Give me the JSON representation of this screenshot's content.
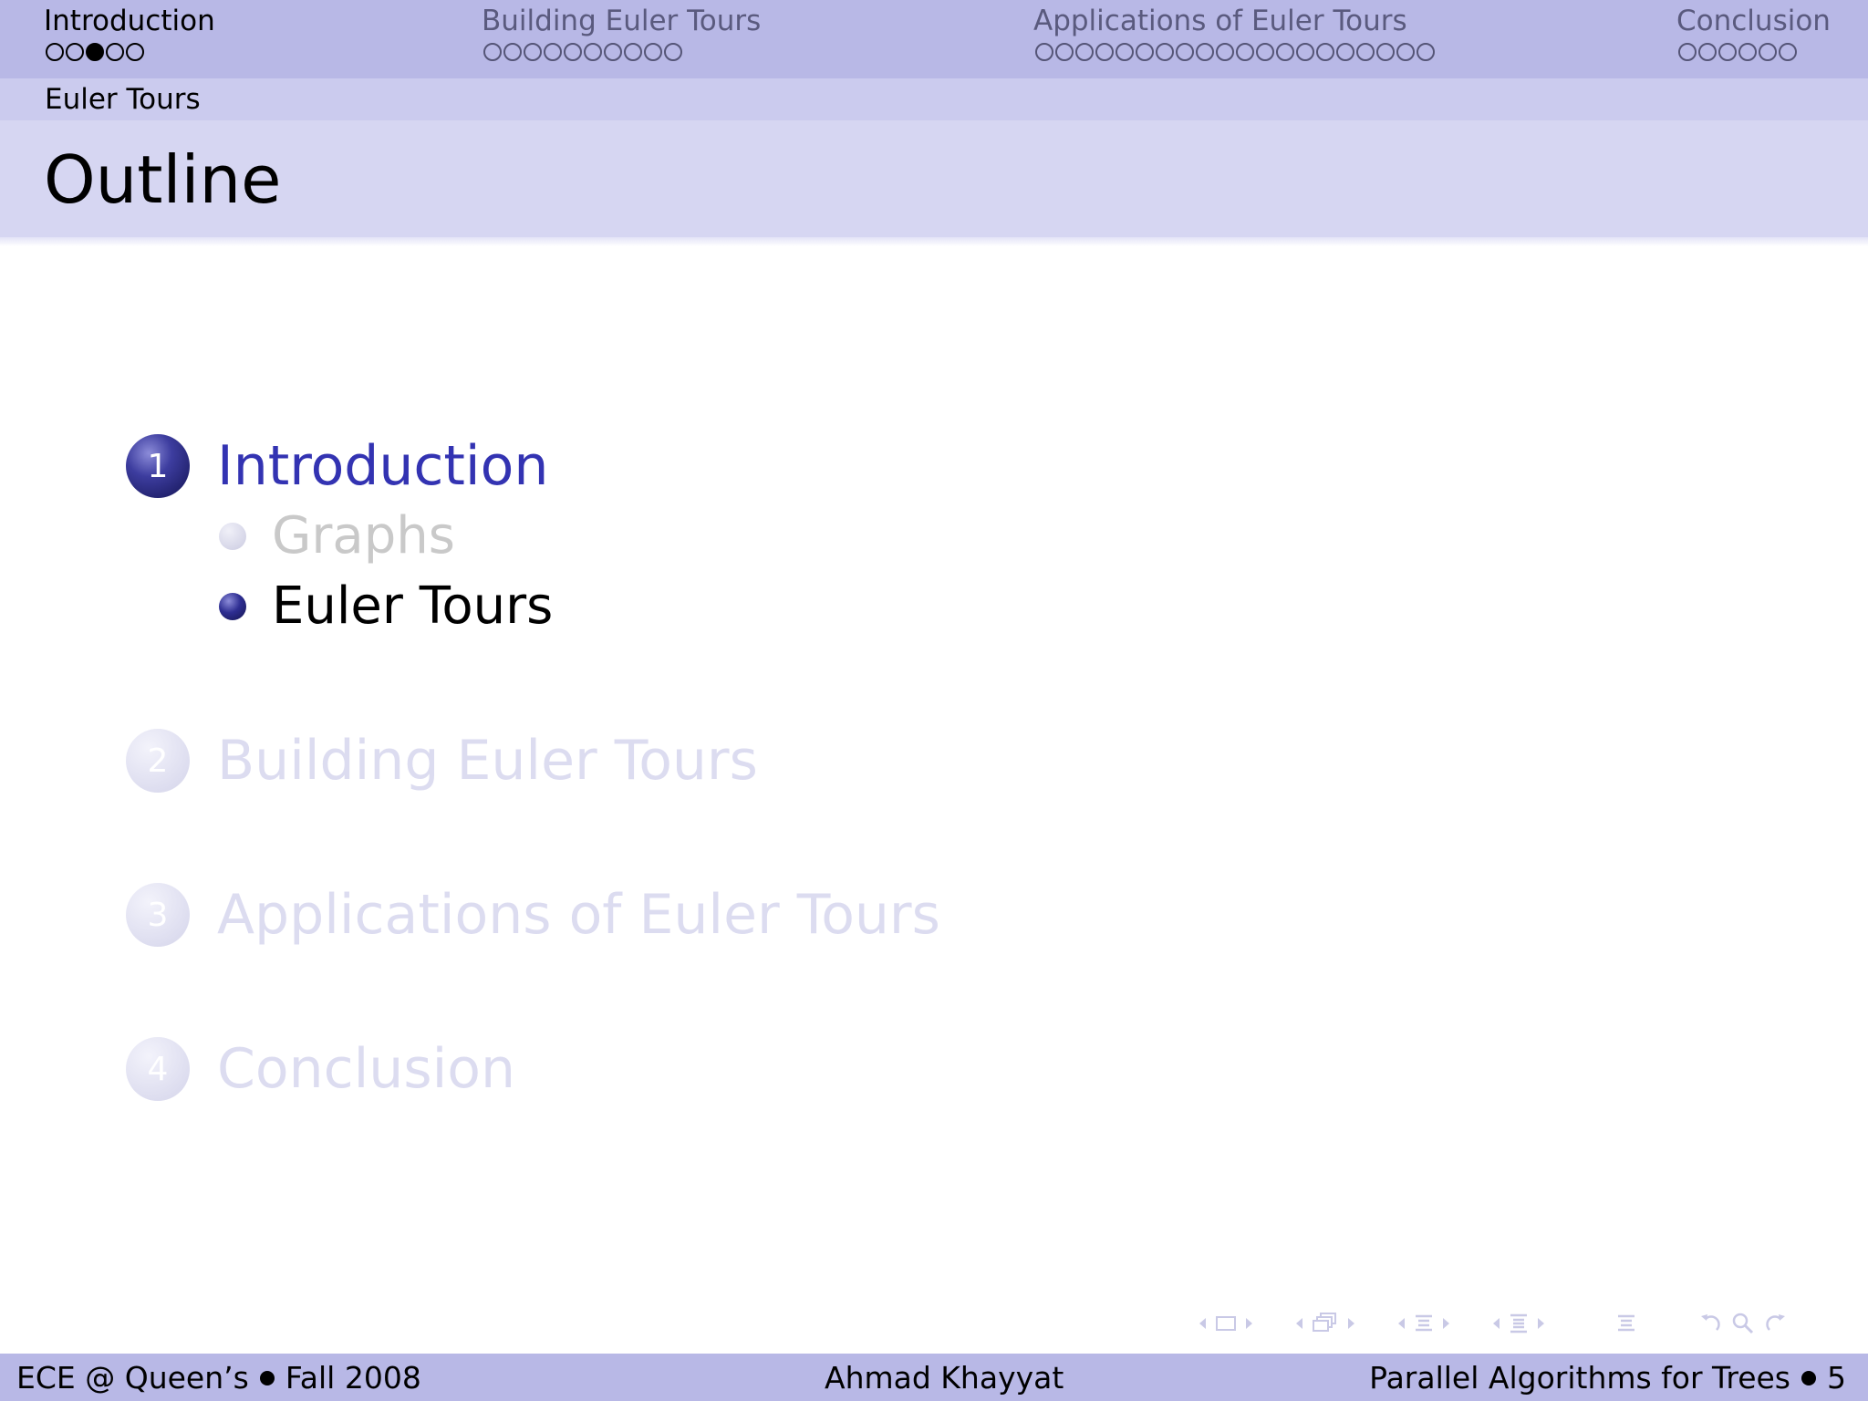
{
  "headline": {
    "sections": [
      {
        "title": "Introduction",
        "dots": 5,
        "current_dot": 3,
        "active": true
      },
      {
        "title": "Building Euler Tours",
        "dots": 10,
        "current_dot": 0,
        "active": false
      },
      {
        "title": "Applications of Euler Tours",
        "dots": 20,
        "current_dot": 0,
        "active": false
      },
      {
        "title": "Conclusion",
        "dots": 6,
        "current_dot": 0,
        "active": false
      }
    ]
  },
  "subsection": "Euler Tours",
  "frame_title": "Outline",
  "outline": {
    "sections": [
      {
        "number": "1",
        "title": "Introduction",
        "state": "active"
      },
      {
        "number": "2",
        "title": "Building Euler Tours",
        "state": "faded"
      },
      {
        "number": "3",
        "title": "Applications of Euler Tours",
        "state": "faded"
      },
      {
        "number": "4",
        "title": "Conclusion",
        "state": "faded"
      }
    ],
    "subsections": [
      {
        "title": "Graphs",
        "state": "faded"
      },
      {
        "title": "Euler Tours",
        "state": "active"
      }
    ]
  },
  "nav_symbols": [
    "left-arrow-icon",
    "frame-icon",
    "right-arrow-icon",
    "left-arrow-icon",
    "subsection-icon",
    "right-arrow-icon",
    "left-arrow-icon",
    "section-icon",
    "right-arrow-icon",
    "left-arrow-icon",
    "presentation-icon",
    "right-arrow-icon",
    "outline-icon",
    "undo-icon",
    "search-icon",
    "redo-icon"
  ],
  "footer": {
    "left_part1": "ECE @ Queen’s",
    "left_part2": "Fall 2008",
    "center": "Ahmad Khayyat",
    "right_title": "Parallel Algorithms for Trees",
    "page_number": "5"
  },
  "colors": {
    "headline_bg": "#b8b8e6",
    "title_bg": "#d6d6f2",
    "accent": "#3333b2",
    "faded": "#dcdcf0"
  }
}
